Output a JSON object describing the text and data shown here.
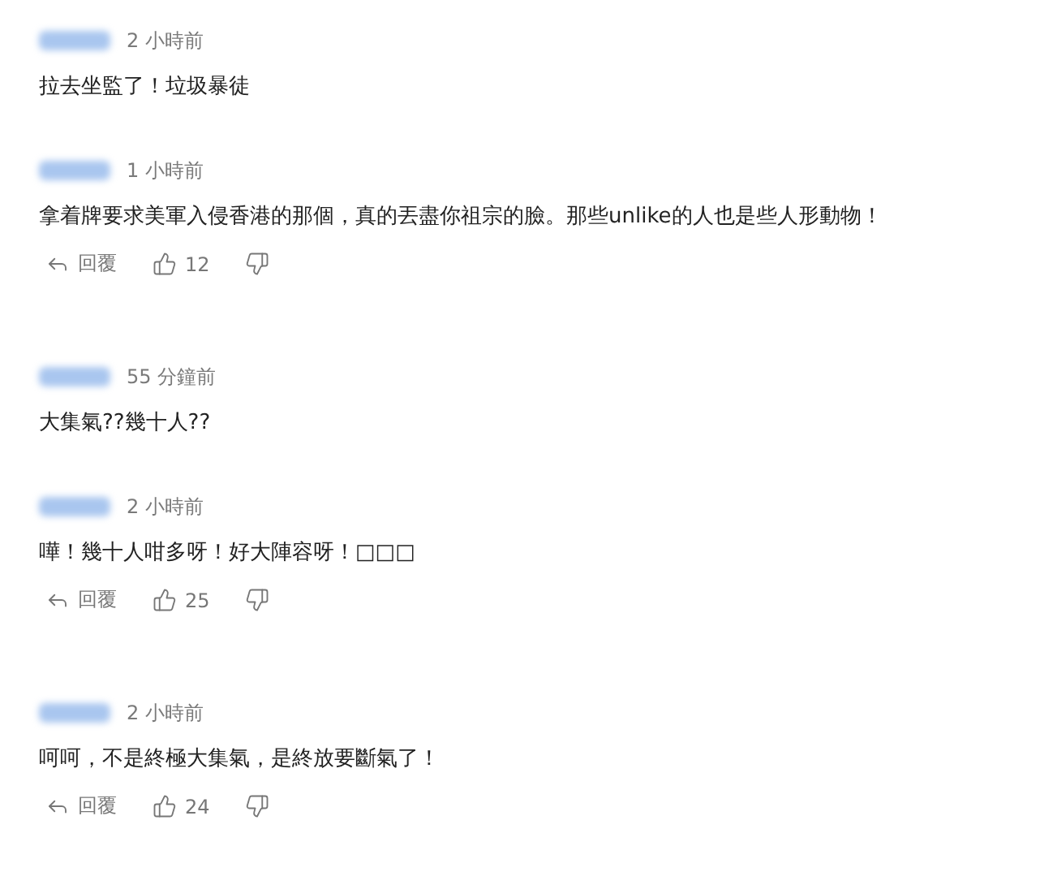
{
  "comments": [
    {
      "time": "2 小時前",
      "text": "拉去坐監了！垃圾暴徒"
    },
    {
      "time": "1 小時前",
      "text": "拿着牌要求美軍入侵香港的那個，真的丟盡你祖宗的臉。那些unlike的人也是些人形動物！",
      "actions": {
        "reply": "回覆",
        "likes": "12"
      }
    },
    {
      "time": "55 分鐘前",
      "text": "大集氣??幾十人??"
    },
    {
      "time": "2 小時前",
      "text": "嘩！幾十人咁多呀！好大陣容呀！□□□",
      "actions": {
        "reply": "回覆",
        "likes": "25"
      }
    },
    {
      "time": "2 小時前",
      "text": "呵呵，不是終極大集氣，是終放要斷氣了！",
      "actions": {
        "reply": "回覆",
        "likes": "24"
      }
    }
  ]
}
